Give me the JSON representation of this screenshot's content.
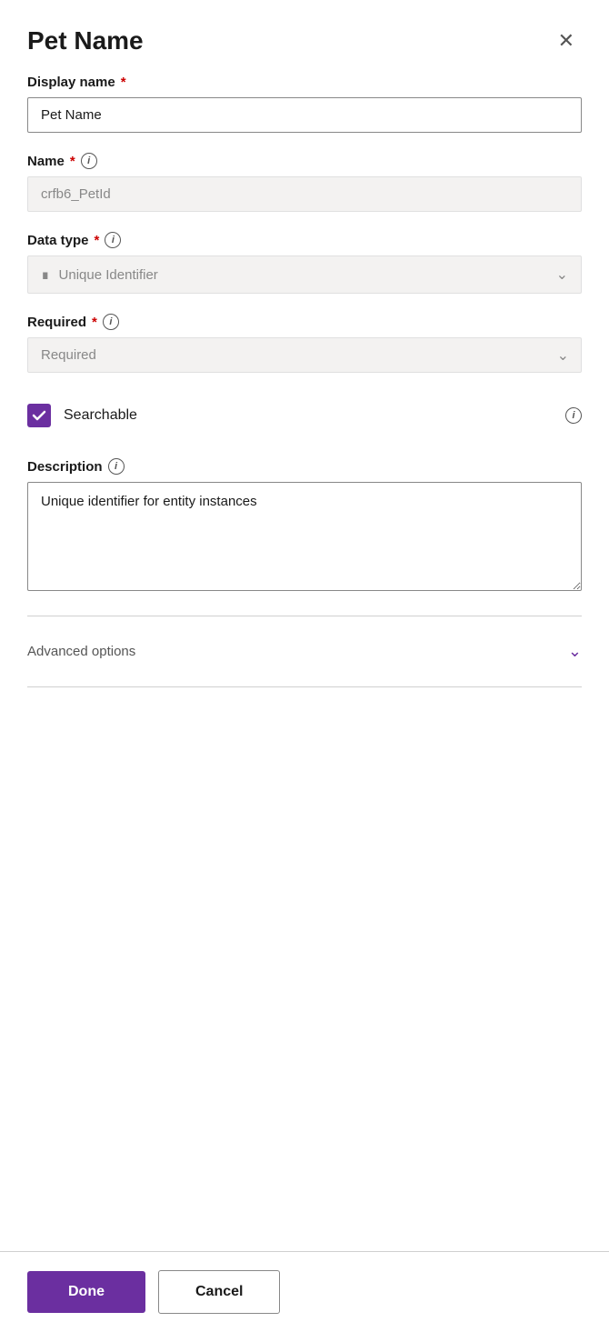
{
  "header": {
    "title": "Pet Name",
    "close_label": "×"
  },
  "fields": {
    "display_name": {
      "label": "Display name",
      "required": true,
      "value": "Pet Name",
      "placeholder": "Pet Name"
    },
    "name": {
      "label": "Name",
      "required": true,
      "info": true,
      "value": "crfb6_PetId",
      "disabled": true
    },
    "data_type": {
      "label": "Data type",
      "required": true,
      "info": true,
      "value": "Unique Identifier",
      "icon": "⊟"
    },
    "required": {
      "label": "Required",
      "required": true,
      "info": true,
      "value": "Required"
    },
    "searchable": {
      "label": "Searchable",
      "checked": true
    },
    "description": {
      "label": "Description",
      "info": true,
      "value": "Unique identifier for entity instances"
    }
  },
  "advanced_options": {
    "label": "Advanced options"
  },
  "footer": {
    "done_label": "Done",
    "cancel_label": "Cancel"
  },
  "icons": {
    "info": "i",
    "close": "×",
    "chevron_down": "∨",
    "checkmark": "✓"
  }
}
